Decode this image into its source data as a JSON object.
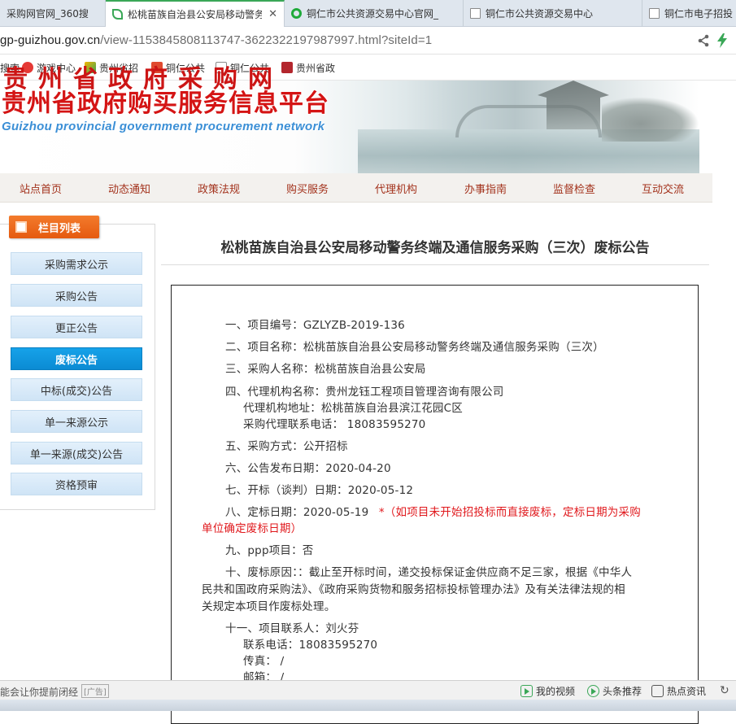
{
  "browser": {
    "tabs": [
      {
        "label": "采购网官网_360搜"
      },
      {
        "label": "松桃苗族自治县公安局移动警务",
        "active": true
      },
      {
        "label": "铜仁市公共资源交易中心官网_"
      },
      {
        "label": "铜仁市公共资源交易中心"
      },
      {
        "label": "铜仁市电子招投"
      }
    ],
    "url_host": "gp-guizhou.gov.cn",
    "url_path": "/view-1153845808113747-3622322197987997.html?siteId=1",
    "bookmarks": [
      {
        "label": "搜索"
      },
      {
        "label": "游戏中心"
      },
      {
        "label": "贵州省招"
      },
      {
        "label": "铜仁公共"
      },
      {
        "label": "铜仁公共"
      },
      {
        "label": "贵州省政"
      }
    ]
  },
  "site": {
    "title_cut": "贵州省政府采购网",
    "title": "贵州省政府购买服务信息平台",
    "subtitle": "Guizhou provincial government procurement network",
    "nav": [
      "站点首页",
      "动态通知",
      "政策法规",
      "购买服务",
      "代理机构",
      "办事指南",
      "监督检查",
      "互动交流"
    ]
  },
  "sidebar": {
    "heading": "栏目列表",
    "items": [
      {
        "label": "采购需求公示"
      },
      {
        "label": "采购公告"
      },
      {
        "label": "更正公告"
      },
      {
        "label": "废标公告",
        "active": true
      },
      {
        "label": "中标(成交)公告"
      },
      {
        "label": "单一来源公示"
      },
      {
        "label": "单一来源(成交)公告"
      },
      {
        "label": "资格预审"
      }
    ]
  },
  "article": {
    "title": "松桃苗族自治县公安局移动警务终端及通信服务采购（三次）废标公告",
    "lines": {
      "l1": "一、项目编号：GZLYZB-2019-136",
      "l2": "二、项目名称：松桃苗族自治县公安局移动警务终端及通信服务采购（三次）",
      "l3": "三、采购人名称：松桃苗族自治县公安局",
      "l4": "四、代理机构名称：贵州龙钰工程项目管理咨询有限公司",
      "l4a": "代理机构地址：松桃苗族自治县滨江花园C区",
      "l4b": "采购代理联系电话： 18083595270",
      "l5": "五、采购方式：公开招标",
      "l6": "六、公告发布日期：2020-04-20",
      "l7": "七、开标（谈判）日期：2020-05-12",
      "l8": "八、定标日期：2020-05-19",
      "l8_note1": "*（如项目未开始招投标而直接废标，定标日期为采购",
      "l8_note2": "单位确定废标日期）",
      "l9": "九、ppp项目：否",
      "l10a": "十、废标原因：：截止至开标时间，递交投标保证金供应商不足三家，根据《中华人",
      "l10b": "民共和国政府采购法》、《政府采购货物和服务招标投标管理办法》及有关法律法规的相",
      "l10c": "关规定本项目作废标处理。",
      "l11": "十一、项目联系人：刘火芬",
      "l11a": "联系电话：18083595270",
      "l11b": "传真： /",
      "l11c": "邮箱： /"
    }
  },
  "statusbar": {
    "left": "能会让你提前闭经",
    "left_box": "[广告]",
    "items": [
      "我的视频",
      "头条推荐",
      "热点资讯"
    ]
  },
  "colors": {
    "accent_green": "#3aa757",
    "title_red": "#d41414",
    "nav_text": "#a3321c",
    "sidebar_active": "#0b8bd3",
    "note_red": "#e0181c"
  }
}
